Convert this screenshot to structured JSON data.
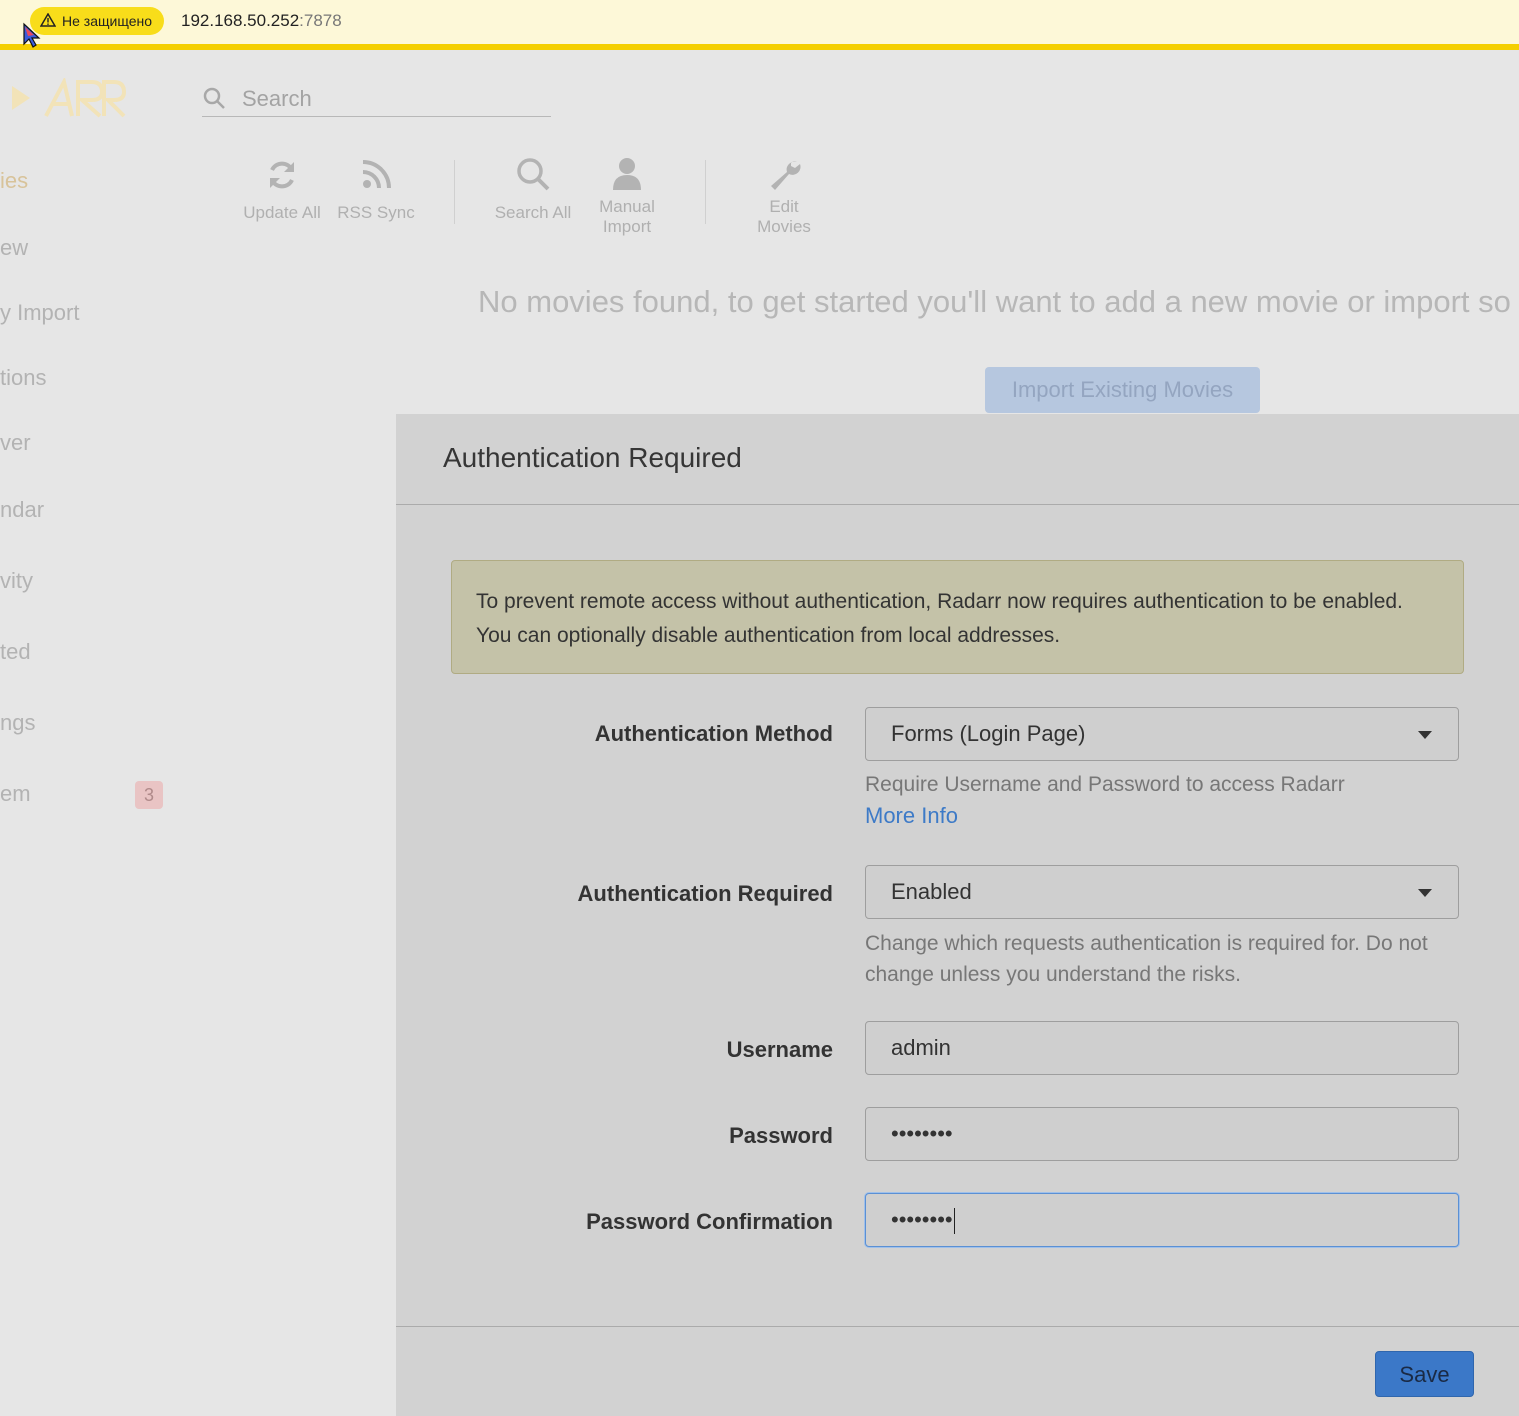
{
  "browser": {
    "security_label": "Не защищено",
    "url_host": "192.168.50.252",
    "url_port": ":7878"
  },
  "header": {
    "search_placeholder": "Search"
  },
  "sidebar": {
    "items": [
      {
        "label": "ies",
        "active": true
      },
      {
        "label": "ew"
      },
      {
        "label": "y Import"
      },
      {
        "label": "tions"
      },
      {
        "label": "ver"
      },
      {
        "label": "ndar"
      },
      {
        "label": "vity"
      },
      {
        "label": "ted"
      },
      {
        "label": "ngs"
      },
      {
        "label": "em",
        "badge": "3"
      }
    ]
  },
  "toolbar": {
    "update_all": "Update All",
    "rss_sync": "RSS Sync",
    "search_all": "Search All",
    "manual_import_line1": "Manual",
    "manual_import_line2": "Import",
    "edit_movies_line1": "Edit",
    "edit_movies_line2": "Movies"
  },
  "main": {
    "empty_message": "No movies found, to get started you'll want to add a new movie or import so",
    "import_button": "Import Existing Movies"
  },
  "modal": {
    "title": "Authentication Required",
    "alert_line1": "To prevent remote access without authentication, Radarr now requires authentication to be enabled.",
    "alert_line2": "You can optionally disable authentication from local addresses.",
    "auth_method_label": "Authentication Method",
    "auth_method_value": "Forms (Login Page)",
    "auth_method_help": "Require Username and Password to access Radarr",
    "more_info": "More Info",
    "auth_required_label": "Authentication Required",
    "auth_required_value": "Enabled",
    "auth_required_help_line1": "Change which requests authentication is required for. Do not",
    "auth_required_help_line2": "change unless you understand the risks.",
    "username_label": "Username",
    "username_value": "admin",
    "password_label": "Password",
    "password_value": "••••••••",
    "password_confirm_label": "Password Confirmation",
    "password_confirm_value": "••••••••",
    "save_button": "Save"
  },
  "colors": {
    "accent_blue": "#3b78c8",
    "address_bar_border": "#f4cf00",
    "alert_bg": "#c4c2a8"
  }
}
